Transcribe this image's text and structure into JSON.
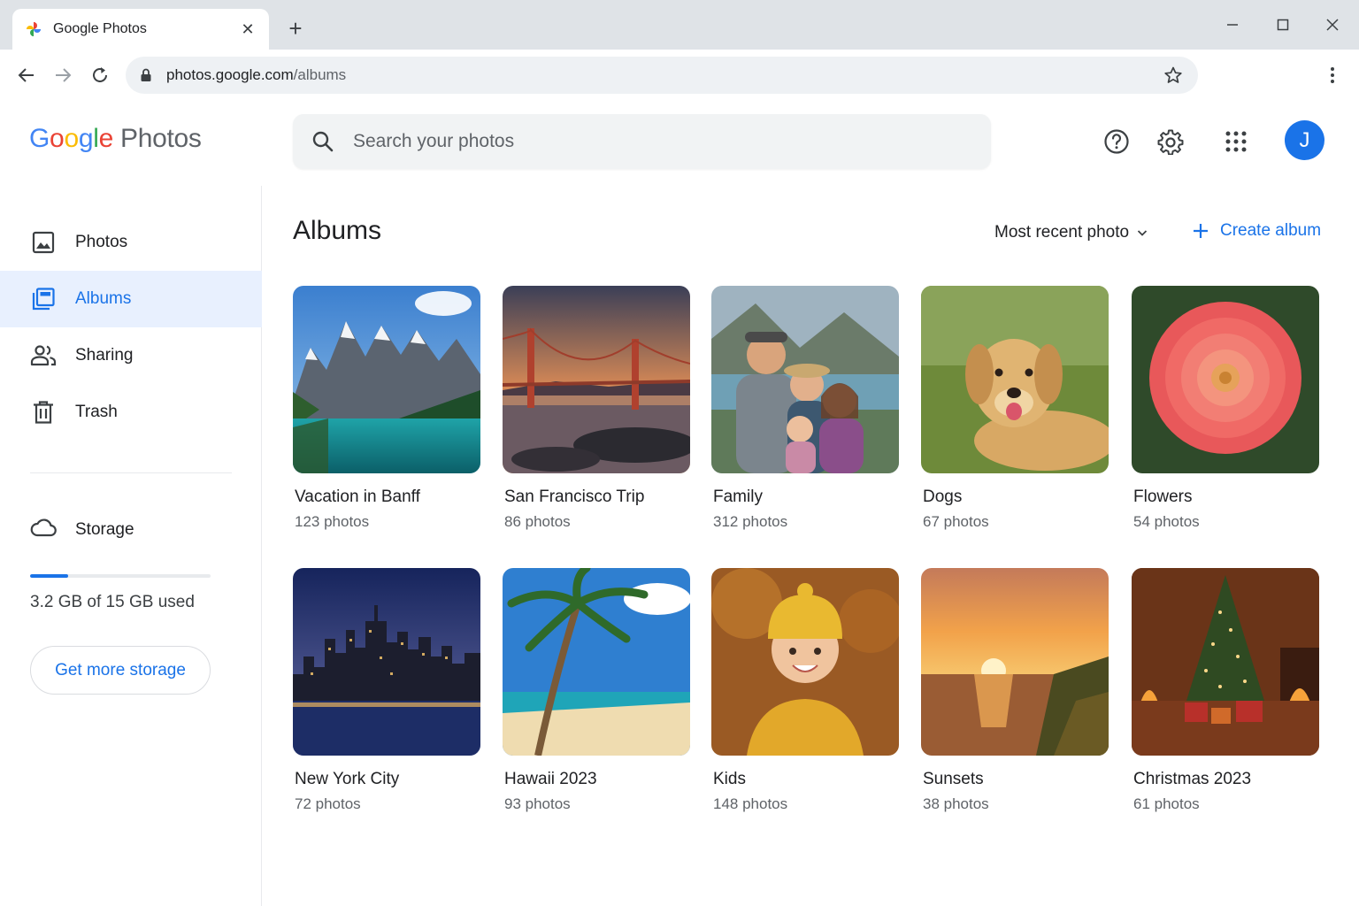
{
  "browser": {
    "tab_title": "Google Photos",
    "url_host": "photos.google.com",
    "url_path": "/albums"
  },
  "app": {
    "logo_letters": [
      "G",
      "o",
      "o",
      "g",
      "l",
      "e"
    ],
    "logo_product": "Photos",
    "search_placeholder": "Search your photos",
    "avatar_initial": "J",
    "accent_color": "#1a73e8"
  },
  "sidebar": {
    "items": [
      {
        "label": "Photos",
        "icon": "image-icon"
      },
      {
        "label": "Albums",
        "icon": "albums-icon",
        "active": true
      },
      {
        "label": "Sharing",
        "icon": "people-icon"
      },
      {
        "label": "Trash",
        "icon": "trash-icon"
      }
    ],
    "storage_label": "Storage",
    "storage_used_text": "3.2 GB of 15 GB used",
    "storage_used_fraction": 0.213,
    "get_more_label": "Get more storage"
  },
  "main": {
    "title": "Albums",
    "sort_label": "Most recent photo",
    "create_label": "Create album",
    "albums": [
      {
        "title": "Vacation in Banff",
        "count": "123 photos"
      },
      {
        "title": "San Francisco Trip",
        "count": "86 photos"
      },
      {
        "title": "Family",
        "count": "312 photos"
      },
      {
        "title": "Dogs",
        "count": "67 photos"
      },
      {
        "title": "Flowers",
        "count": "54 photos"
      },
      {
        "title": "New York City",
        "count": "72 photos"
      },
      {
        "title": "Hawaii 2023",
        "count": "93 photos"
      },
      {
        "title": "Kids",
        "count": "148 photos"
      },
      {
        "title": "Sunsets",
        "count": "38 photos"
      },
      {
        "title": "Christmas 2023",
        "count": "61 photos"
      }
    ]
  }
}
